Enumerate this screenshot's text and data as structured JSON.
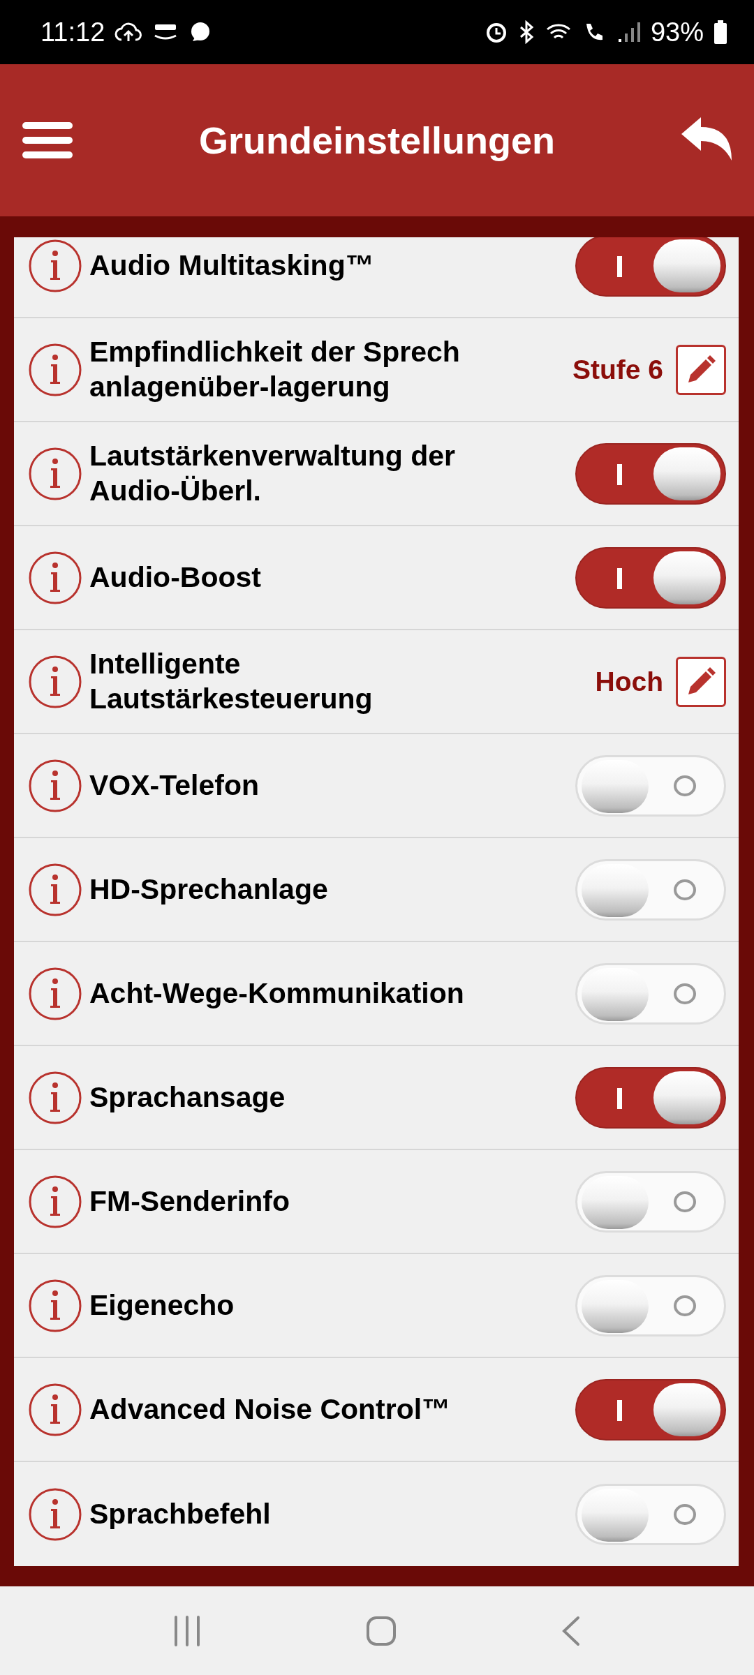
{
  "status_bar": {
    "time": "11:12",
    "battery": "93%"
  },
  "header": {
    "title": "Grundeinstellungen"
  },
  "settings": [
    {
      "kind": "toggle",
      "label": "Audio Multitasking™",
      "on": true
    },
    {
      "kind": "value",
      "label": "Empfindlichkeit der Sprech anlagenüber-lagerung",
      "value": "Stufe 6"
    },
    {
      "kind": "toggle",
      "label": "Lautstärkenverwaltung der Audio-Überl.",
      "on": true
    },
    {
      "kind": "toggle",
      "label": "Audio-Boost",
      "on": true
    },
    {
      "kind": "value",
      "label": "Intelligente Lautstärkesteuerung",
      "value": "Hoch"
    },
    {
      "kind": "toggle",
      "label": "VOX-Telefon",
      "on": false
    },
    {
      "kind": "toggle",
      "label": "HD-Sprechanlage",
      "on": false
    },
    {
      "kind": "toggle",
      "label": "Acht-Wege-Kommunikation",
      "on": false
    },
    {
      "kind": "toggle",
      "label": "Sprachansage",
      "on": true
    },
    {
      "kind": "toggle",
      "label": "FM-Senderinfo",
      "on": false
    },
    {
      "kind": "toggle",
      "label": "Eigenecho",
      "on": false
    },
    {
      "kind": "toggle",
      "label": "Advanced Noise Control™",
      "on": true
    },
    {
      "kind": "toggle",
      "label": "Sprachbefehl",
      "on": false
    }
  ]
}
